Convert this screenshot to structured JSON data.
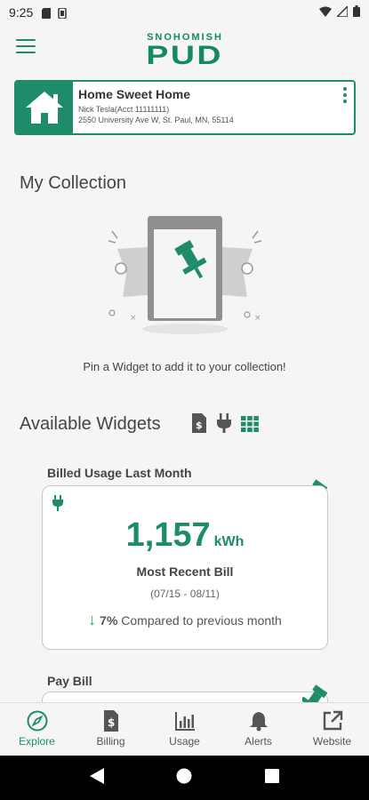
{
  "status_bar": {
    "time": "9:25"
  },
  "header": {
    "logo_top": "SNOHOMISH",
    "logo_bottom": "PUD"
  },
  "account": {
    "name": "Home Sweet Home",
    "holder": "Nick Tesla(Acct 11111111)",
    "address": "2550 University Ave W, St. Paul, MN, 55114"
  },
  "collection": {
    "title": "My Collection",
    "empty_text": "Pin a Widget to add it to your collection!"
  },
  "available": {
    "title": "Available Widgets"
  },
  "widgets": {
    "billed_usage": {
      "title": "Billed Usage Last Month",
      "value": "1,157",
      "unit": "kWh",
      "subtitle": "Most Recent Bill",
      "period": "(07/15 - 08/11)",
      "change_pct": "7%",
      "change_text": "Compared to previous month"
    },
    "pay_bill": {
      "title": "Pay Bill"
    }
  },
  "bottom_nav": [
    {
      "label": "Explore",
      "icon": "compass-icon",
      "active": true
    },
    {
      "label": "Billing",
      "icon": "bill-icon"
    },
    {
      "label": "Usage",
      "icon": "bar-chart-icon"
    },
    {
      "label": "Alerts",
      "icon": "bell-icon"
    },
    {
      "label": "Website",
      "icon": "external-link-icon"
    }
  ],
  "colors": {
    "brand": "#1e8c6a",
    "down_arrow": "#2aa84a"
  }
}
